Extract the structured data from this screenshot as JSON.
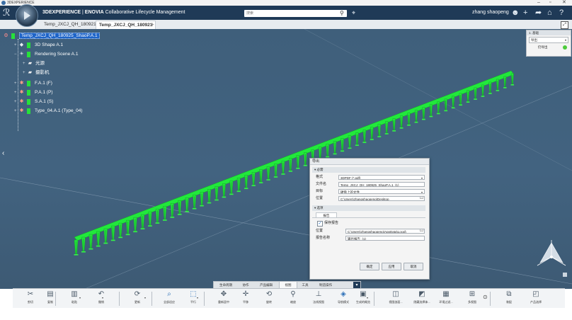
{
  "os": {
    "title": "3DEXPERIENCE",
    "controls": [
      "–",
      "▫",
      "✕"
    ]
  },
  "header": {
    "title_brand": "3DEXPERIENCE",
    "title_sep": " | ",
    "title_app": "ENOVIA",
    "title_rest": " Collaborative Lifecycle Management",
    "search_placeholder": "搜索",
    "user": "zhang shaopeng"
  },
  "tabs": [
    {
      "label": "Temp_JXCJ_QH_180921"
    },
    {
      "label": "Temp_JXCJ_QH_180921"
    }
  ],
  "tab_add": "+",
  "tree": {
    "root": "Temp_JXCJ_QH_180925_ShaoP.A.1",
    "items": [
      {
        "label": "3D Shape A.1"
      },
      {
        "label": "Rendering Scene A.1"
      },
      {
        "label": "光源"
      },
      {
        "label": "摄影机"
      },
      {
        "label": "F.A.1 (F)"
      },
      {
        "label": "P.A.1 (P)"
      },
      {
        "label": "S.A.1 (S)"
      },
      {
        "label": "Type_04.A.1 (Type_04)"
      }
    ]
  },
  "mini_panel": {
    "title": "1. 基础",
    "select": "导出",
    "row": "仍导出"
  },
  "dialog": {
    "title": "导出",
    "section_required": "▾ 必需",
    "format_label": "格式",
    "format_value": "3DPDF (*.pdf)",
    "filename_label": "文件名",
    "filename_value": "Temp_JXCJ_QH_180925_ShaoP.A.1_(1)",
    "target_label": "目标",
    "target_value": "硬盘上的文件",
    "location_label": "位置",
    "location_value": "C:\\Users\\zhangshaopeng\\Desktop",
    "section_options": "▾ 选项",
    "report_tab": "报告",
    "save_report": "保存报告",
    "report_location_label": "位置",
    "report_location_value": "C:\\Users\\zhangshaopeng\\AppData\\Local\\",
    "report_name_label": "报告名称",
    "report_name_value": "输出报告_(1)",
    "ok": "确定",
    "apply": "应用",
    "cancel": "取消"
  },
  "action_tabs": [
    "生命周期",
    "协作",
    "产品编辑",
    "视图",
    "工具",
    "制造操作"
  ],
  "action_tabs_active": 3,
  "tools": [
    {
      "name": "cut",
      "label": "剪切",
      "icon": "✂"
    },
    {
      "name": "copy",
      "label": "复制",
      "icon": "▤"
    },
    {
      "name": "paste",
      "label": "粘贴",
      "icon": "▥"
    },
    {
      "name": "undo",
      "label": "撤销",
      "icon": "↶"
    },
    {
      "name": "update",
      "label": "更新",
      "icon": "⟳"
    },
    {
      "name": "fit-all",
      "label": "全部适应",
      "icon": "⌕"
    },
    {
      "name": "pan",
      "label": "平行",
      "icon": "⬚"
    },
    {
      "name": "reframe",
      "label": "重新居中",
      "icon": "✥"
    },
    {
      "name": "translate",
      "label": "平移",
      "icon": "✛"
    },
    {
      "name": "rotate",
      "label": "旋转",
      "icon": "⟲"
    },
    {
      "name": "zoom",
      "label": "缩放",
      "icon": "⚲"
    },
    {
      "name": "normal-view",
      "label": "法线视图",
      "icon": "⊥"
    },
    {
      "name": "nav-mode",
      "label": "导航模式",
      "icon": "◈"
    },
    {
      "name": "render-style",
      "label": "生成的概览",
      "icon": "▣"
    },
    {
      "name": "view-mode",
      "label": "视图剖面...",
      "icon": "◫"
    },
    {
      "name": "selection",
      "label": "隐藏选择体...",
      "icon": "◩"
    },
    {
      "name": "env",
      "label": "环境过滤...",
      "icon": "▦"
    },
    {
      "name": "multi-view",
      "label": "多视图",
      "icon": "⊞"
    },
    {
      "name": "assembly",
      "label": "装配",
      "icon": "⧉"
    },
    {
      "name": "product-select",
      "label": "产品选择",
      "icon": "◰"
    }
  ],
  "colors": {
    "header": "#1f3a57",
    "viewport": "#426380",
    "model_green": "#22e83c",
    "selection": "#1e64c8"
  }
}
